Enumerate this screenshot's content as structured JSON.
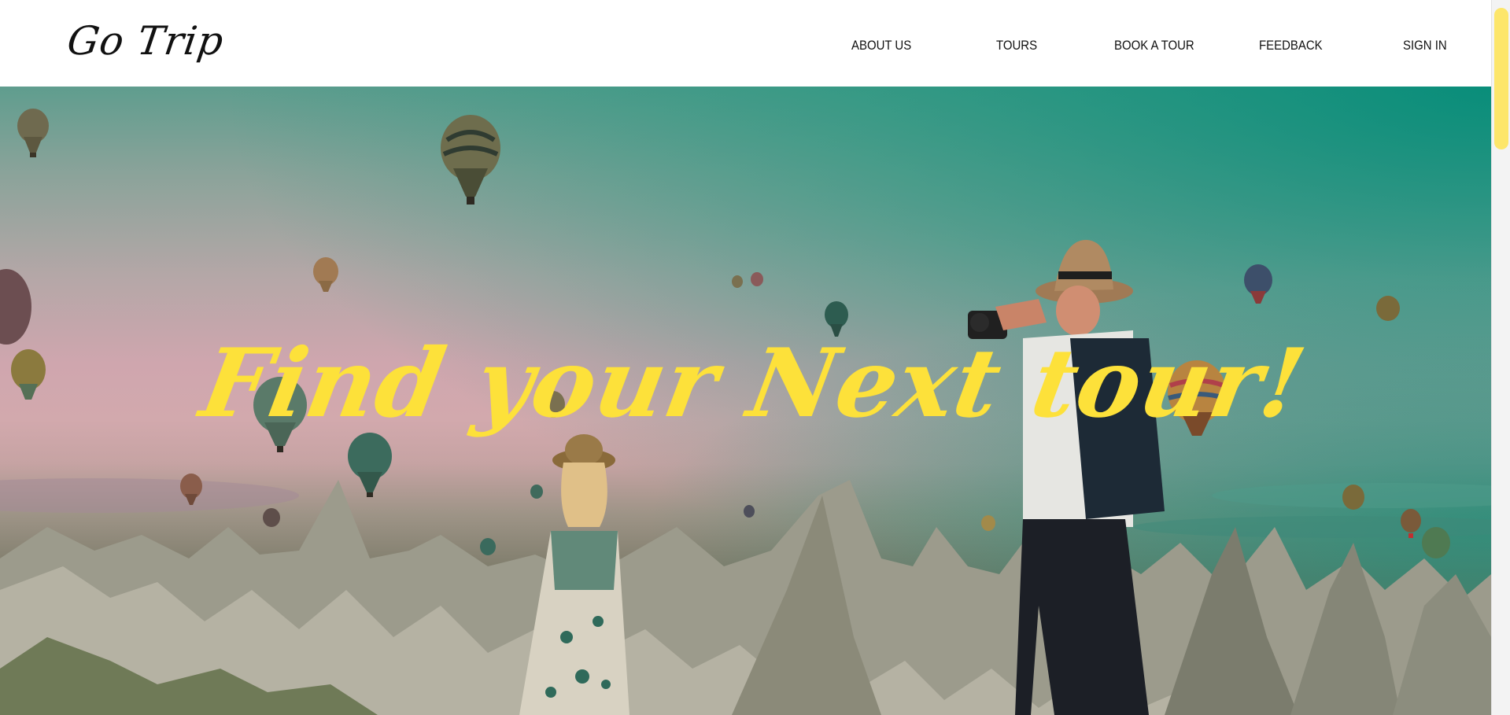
{
  "header": {
    "logo": "Go Trip",
    "nav": [
      {
        "label": "ABOUT US"
      },
      {
        "label": "TOURS"
      },
      {
        "label": "BOOK A TOUR"
      },
      {
        "label": "FEEDBACK"
      },
      {
        "label": "SIGN IN"
      }
    ]
  },
  "hero": {
    "title": "Find your Next tour!",
    "title_color": "#fde13a",
    "image_description_icon": "hot-air-balloons-photo"
  },
  "scrollbar": {
    "thumb_color": "#fde66a",
    "position": 0
  }
}
